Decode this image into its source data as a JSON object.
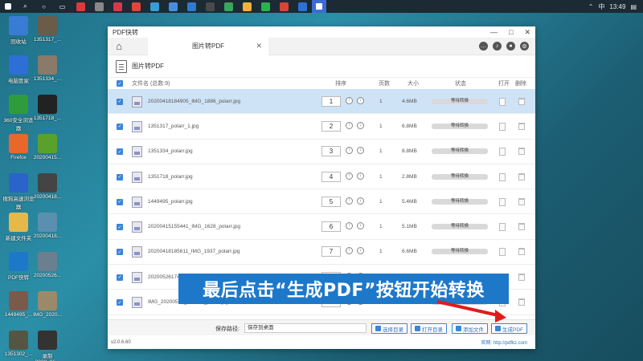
{
  "taskbar": {
    "icons": [
      "windows-icon",
      "search-icon",
      "circle-icon",
      "taskview-icon",
      "app1-icon",
      "app2-icon",
      "app3-icon",
      "app4-icon",
      "app5-icon",
      "app6-icon",
      "app7-icon",
      "app8-icon",
      "app9-icon",
      "app10-icon",
      "app11-icon",
      "app12-icon",
      "app13-icon",
      "app14-icon"
    ],
    "input_method": "中",
    "time": "13:49"
  },
  "desktop": {
    "icons": [
      {
        "label": "回收站",
        "color": "#3a7bd5"
      },
      {
        "label": "1351317_...",
        "color": "#6b5b4b"
      },
      {
        "label": "电脑管家",
        "color": "#2d6fd6"
      },
      {
        "label": "1351334_...",
        "color": "#8a7a6a"
      },
      {
        "label": "360安全浏览器",
        "color": "#2e9c3a"
      },
      {
        "label": "1351718_...",
        "color": "#222"
      },
      {
        "label": "Firefox",
        "color": "#e8682c"
      },
      {
        "label": "20200415...",
        "color": "#5aa02c"
      },
      {
        "label": "搜狗高速浏览器",
        "color": "#2a63c9"
      },
      {
        "label": "20200418...",
        "color": "#444"
      },
      {
        "label": "新建文件夹",
        "color": "#e6b84a"
      },
      {
        "label": "20200418...",
        "color": "#5b8fb0"
      },
      {
        "label": "PDF快转",
        "color": "#1e78c9"
      },
      {
        "label": "20200526...",
        "color": "#6a7f8f"
      },
      {
        "label": "1449495_...",
        "color": "#7a5a4a"
      },
      {
        "label": "IMG_2020...",
        "color": "#9a8a6a"
      },
      {
        "label": "1351302_...",
        "color": "#554"
      },
      {
        "label": "录制_2020_06_...",
        "color": "#333"
      }
    ]
  },
  "window": {
    "title": "PDF快转",
    "controls": [
      "—",
      "□",
      "✕"
    ],
    "tab_label": "图片转PDF",
    "tab_close": "✕",
    "section_title": "图片转PDF",
    "list_header": {
      "filename": "文件名 (总数:9)",
      "order": "排序",
      "pages": "页数",
      "size": "大小",
      "status": "状态",
      "open": "打开",
      "delete": "删除"
    },
    "rows": [
      {
        "name": "20200418184905_IMG_1886_polarr.jpg",
        "order": "1",
        "pages": "1",
        "size": "4.6MB",
        "status": "等待转换",
        "selected": true
      },
      {
        "name": "1351317_polarr_1.jpg",
        "order": "2",
        "pages": "1",
        "size": "6.8MB",
        "status": "等待转换",
        "selected": false
      },
      {
        "name": "1351334_polarr.jpg",
        "order": "3",
        "pages": "1",
        "size": "8.8MB",
        "status": "等待转换",
        "selected": false
      },
      {
        "name": "1351718_polarr.jpg",
        "order": "4",
        "pages": "1",
        "size": "2.8MB",
        "status": "等待转换",
        "selected": false
      },
      {
        "name": "1449495_polarr.jpg",
        "order": "5",
        "pages": "1",
        "size": "5.4MB",
        "status": "等待转换",
        "selected": false
      },
      {
        "name": "20200415155441_IMG_1628_polarr.jpg",
        "order": "6",
        "pages": "1",
        "size": "5.1MB",
        "status": "等待转换",
        "selected": false
      },
      {
        "name": "20200418185611_IMG_1937_polarr.jpg",
        "order": "7",
        "pages": "1",
        "size": "6.6MB",
        "status": "等待转换",
        "selected": false
      },
      {
        "name": "20200526174...",
        "order": "8",
        "pages": "1",
        "size": "",
        "status": "等待转换",
        "selected": false
      },
      {
        "name": "IMG_20200529_182112_polarr.jpg",
        "order": "9",
        "pages": "1",
        "size": "5.2MB",
        "status": "等待转换",
        "selected": false
      }
    ],
    "bottom": {
      "path_label": "保存路径:",
      "path_value": "保存到桌面",
      "btn_choose": "选择目录",
      "btn_open": "打开目录",
      "btn_add": "添加文件",
      "btn_generate": "生成PDF"
    },
    "footer": {
      "version": "v2.0.6.60",
      "site": "官网: http://pdfkz.com"
    }
  },
  "caption": "最后点击“生成PDF”按钮开始转换"
}
